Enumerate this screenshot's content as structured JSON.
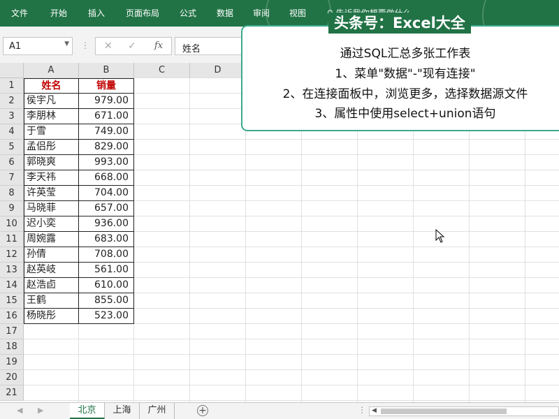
{
  "ribbon": {
    "tabs": [
      "文件",
      "开始",
      "插入",
      "页面布局",
      "公式",
      "数据",
      "审阅",
      "视图"
    ],
    "tell_me": "告诉我你想要做什么"
  },
  "formula_bar": {
    "name_box": "A1",
    "fx_label": "fx",
    "content": "姓名"
  },
  "sheet": {
    "columns": [
      "A",
      "B",
      "C",
      "D"
    ],
    "row_numbers": [
      "1",
      "2",
      "3",
      "4",
      "5",
      "6",
      "7",
      "8",
      "9",
      "10",
      "11",
      "12",
      "13",
      "14",
      "15",
      "16",
      "17",
      "18",
      "19",
      "20",
      "21"
    ],
    "header": {
      "name": "姓名",
      "sales": "销量"
    },
    "rows": [
      {
        "name": "侯宇凡",
        "sales": "979.00"
      },
      {
        "name": "李朋林",
        "sales": "671.00"
      },
      {
        "name": "于雪",
        "sales": "749.00"
      },
      {
        "name": "孟侣彤",
        "sales": "829.00"
      },
      {
        "name": "郭晓爽",
        "sales": "993.00"
      },
      {
        "name": "李天祎",
        "sales": "668.00"
      },
      {
        "name": "许英莹",
        "sales": "704.00"
      },
      {
        "name": "马晓菲",
        "sales": "657.00"
      },
      {
        "name": "迟小奕",
        "sales": "936.00"
      },
      {
        "name": "周婉露",
        "sales": "683.00"
      },
      {
        "name": "孙倩",
        "sales": "708.00"
      },
      {
        "name": "赵英岐",
        "sales": "561.00"
      },
      {
        "name": "赵浩卣",
        "sales": "610.00"
      },
      {
        "name": "王鹤",
        "sales": "855.00"
      },
      {
        "name": "杨晓彤",
        "sales": "523.00"
      }
    ]
  },
  "sheet_tabs": [
    "北京",
    "上海",
    "广州"
  ],
  "active_tab": "北京",
  "overlay": {
    "title": "头条号：Excel大全",
    "lines": [
      "通过SQL汇总多张工作表",
      "1、菜单\"数据\"-\"现有连接\"",
      "2、在连接面板中，浏览更多，选择数据源文件",
      "3、属性中使用select+union语句"
    ]
  },
  "colors": {
    "ribbon": "#217346",
    "header_text": "#c00000",
    "callout_border": "#3aa98d"
  }
}
